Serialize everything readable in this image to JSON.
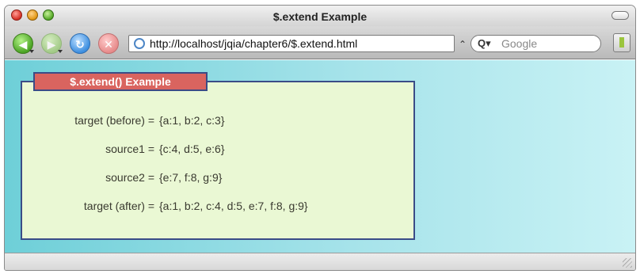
{
  "window": {
    "title": "$.extend Example"
  },
  "toolbar": {
    "url": "http://localhost/jqia/chapter6/$.extend.html",
    "search_placeholder": "Google"
  },
  "page": {
    "legend": "$.extend() Example",
    "rows": [
      {
        "label": "target (before) =",
        "value": "{a:1, b:2, c:3}"
      },
      {
        "label": "source1 =",
        "value": "{c:4, d:5, e:6}"
      },
      {
        "label": "source2 =",
        "value": "{e:7, f:8, g:9}"
      },
      {
        "label": "target (after) =",
        "value": "{a:1, b:2, c:4, d:5, e:7, f:8, g:9}"
      }
    ]
  },
  "colors": {
    "legend_bg": "#d9645f",
    "fieldset_bg": "#eaf8d4",
    "border": "#3b4c87",
    "content_bg": "#a6e3ea"
  }
}
